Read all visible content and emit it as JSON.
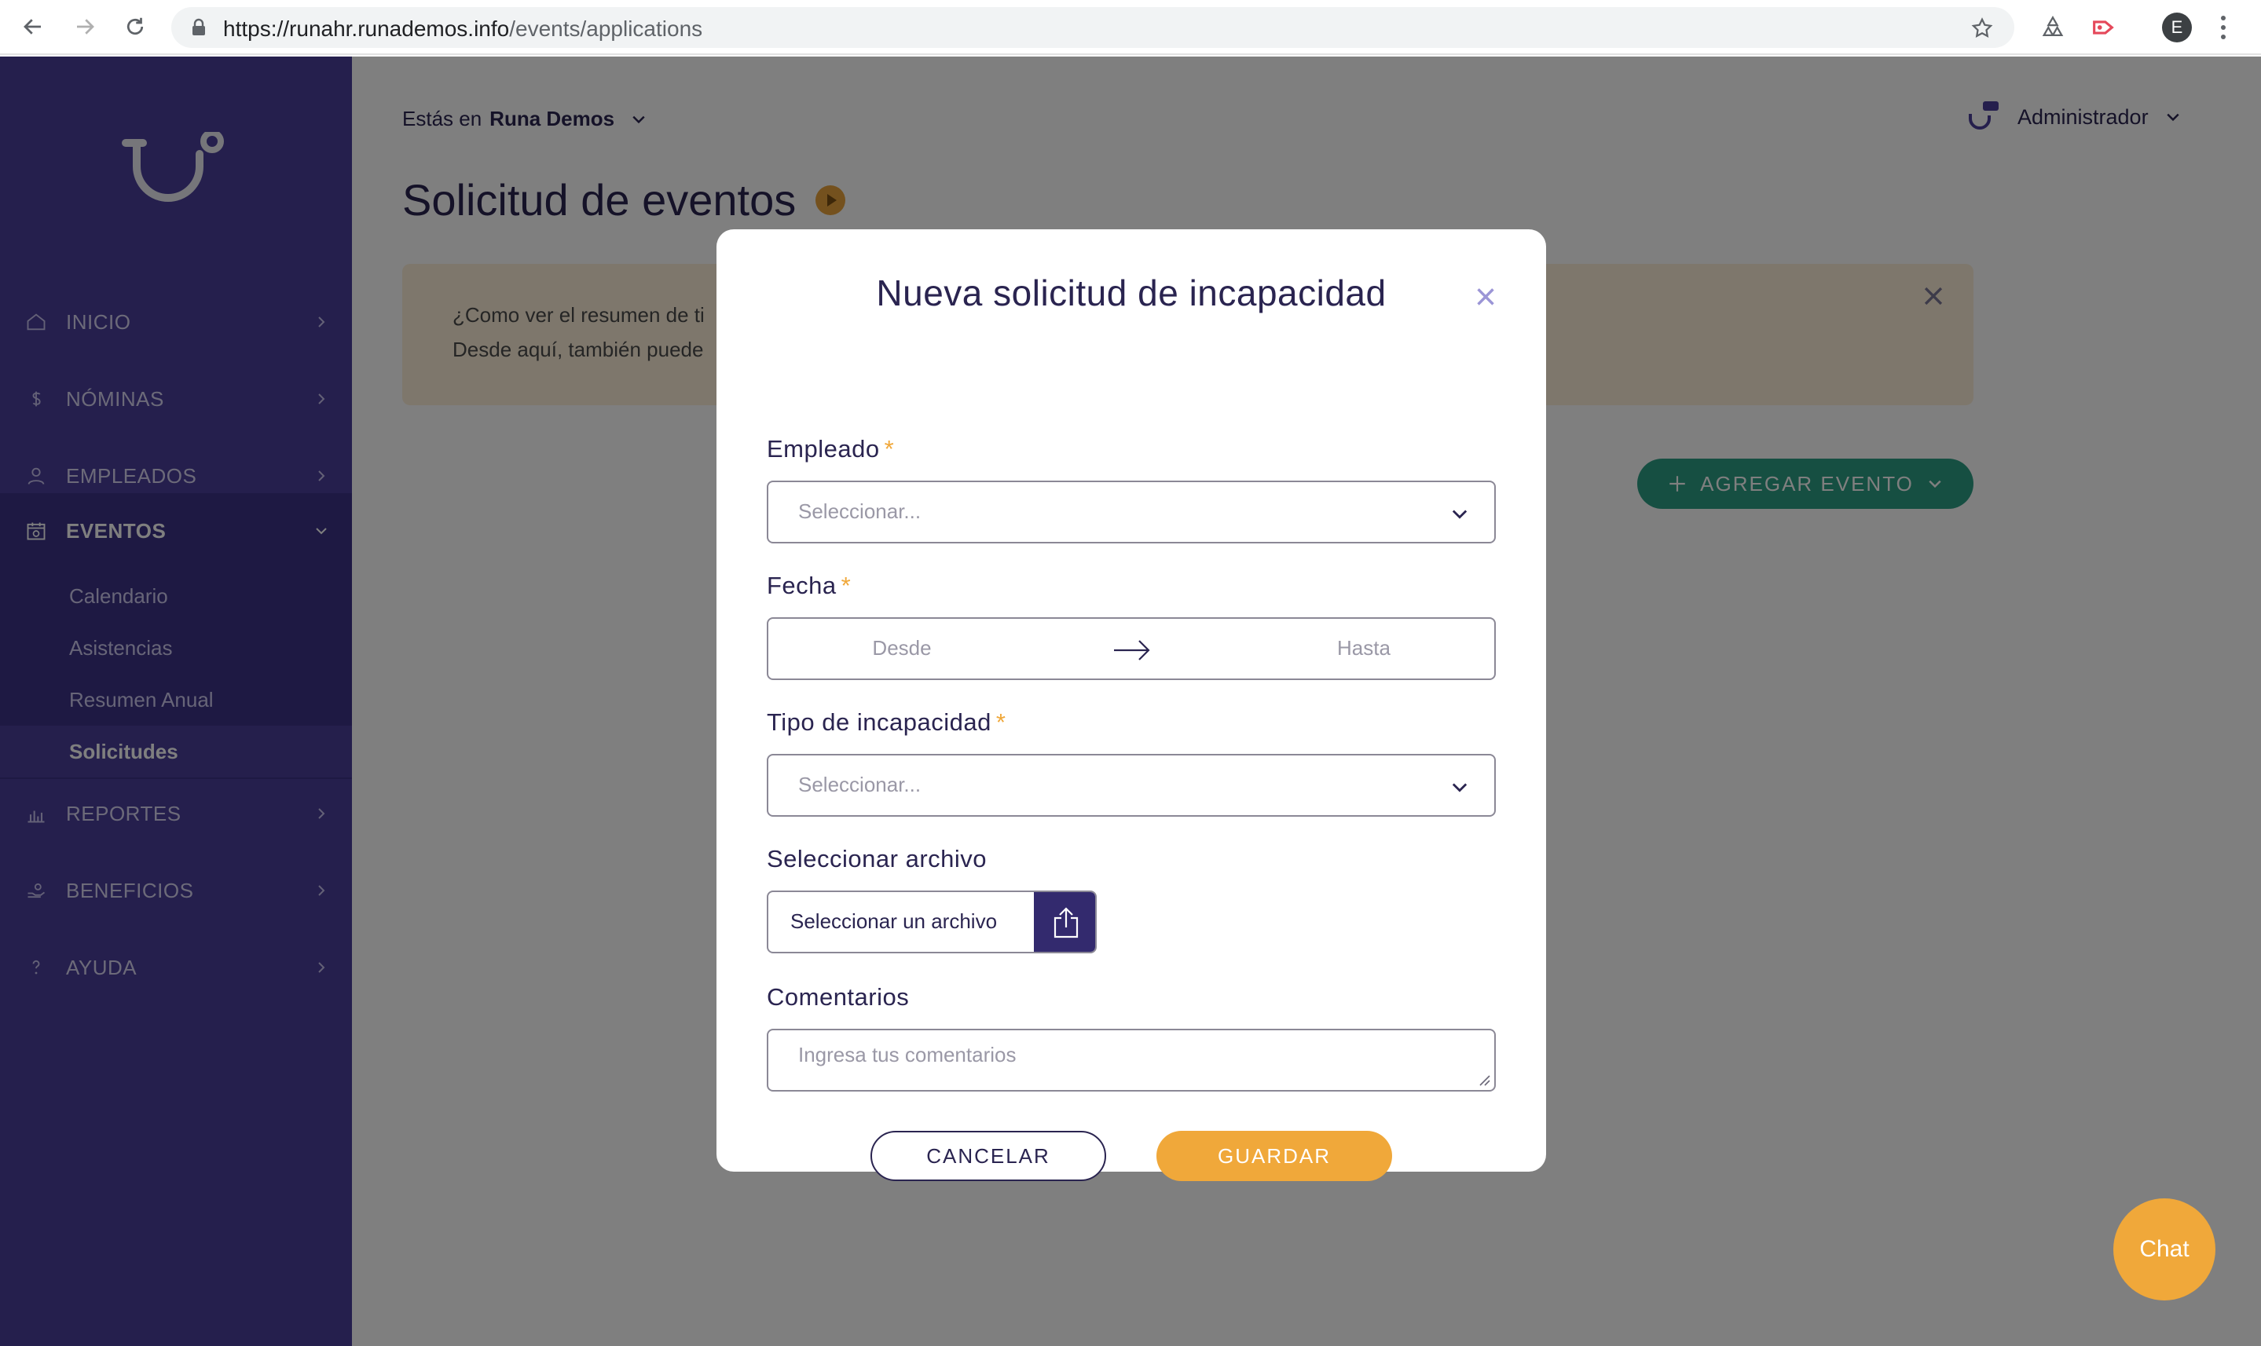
{
  "browser": {
    "url_host": "https://runahr.runademos.info",
    "url_path": "/events/applications",
    "profile_initial": "E"
  },
  "sidebar": {
    "items": [
      {
        "label": "INICIO",
        "icon": "home-icon"
      },
      {
        "label": "NÓMINAS",
        "icon": "dollar-icon"
      },
      {
        "label": "EMPLEADOS",
        "icon": "user-icon"
      },
      {
        "label": "EVENTOS",
        "icon": "calendar-icon"
      },
      {
        "label": "REPORTES",
        "icon": "bar-chart-icon"
      },
      {
        "label": "BENEFICIOS",
        "icon": "gift-icon"
      },
      {
        "label": "AYUDA",
        "icon": "help-icon"
      }
    ],
    "submenu": [
      {
        "label": "Calendario"
      },
      {
        "label": "Asistencias"
      },
      {
        "label": "Resumen Anual"
      },
      {
        "label": "Solicitudes"
      }
    ]
  },
  "header": {
    "company_prefix": "Estás en",
    "company_name": "Runa Demos",
    "user_name": "Administrador"
  },
  "page": {
    "title": "Solicitud de eventos",
    "banner_line1": "¿Como ver el resumen de ti",
    "banner_line2": "Desde aquí, también puede",
    "add_event_label": "AGREGAR EVENTO"
  },
  "modal": {
    "title": "Nueva solicitud de incapacidad",
    "close_symbol": "×",
    "required_mark": "*",
    "employee_label": "Empleado",
    "employee_placeholder": "Seleccionar...",
    "date_label": "Fecha",
    "date_from": "Desde",
    "date_to": "Hasta",
    "type_label": "Tipo de incapacidad",
    "type_placeholder": "Seleccionar...",
    "file_label": "Seleccionar archivo",
    "file_button": "Seleccionar un archivo",
    "comments_label": "Comentarios",
    "comments_placeholder": "Ingresa tus comentarios",
    "cancel_label": "CANCELAR",
    "save_label": "GUARDAR"
  },
  "chat": {
    "label": "Chat"
  },
  "colors": {
    "sidebar": "#4a3f9b",
    "accent": "#f0a83a",
    "primary_dark": "#2a2450",
    "success": "#2d9e85"
  }
}
